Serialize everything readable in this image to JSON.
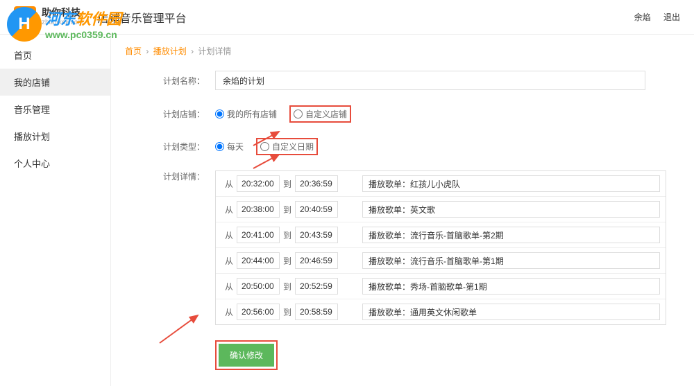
{
  "watermark": {
    "text1_part1": "河东",
    "text1_part2": "软件园",
    "text2": "www.pc0359.cn"
  },
  "header": {
    "logo_letter": "B",
    "logo_text1": "助你科技",
    "logo_text2": "zhunikeji.com",
    "title": "店铺音乐管理平台",
    "user": "余焰",
    "logout": "退出"
  },
  "sidebar": {
    "items": [
      {
        "label": "首页"
      },
      {
        "label": "我的店铺"
      },
      {
        "label": "音乐管理"
      },
      {
        "label": "播放计划"
      },
      {
        "label": "个人中心"
      }
    ]
  },
  "breadcrumb": {
    "item1": "首页",
    "item2": "播放计划",
    "item3": "计划详情"
  },
  "form": {
    "name_label": "计划名称：",
    "name_value": "余焰的计划",
    "shop_label": "计划店铺：",
    "shop_option1": "我的所有店铺",
    "shop_option2": "自定义店铺",
    "type_label": "计划类型：",
    "type_option1": "每天",
    "type_option2": "自定义日期",
    "details_label": "计划详情：",
    "from_label": "从",
    "to_label": "到",
    "playlist_prefix": "播放歌单：",
    "rows": [
      {
        "from": "20:32:00",
        "to": "20:36:59",
        "playlist": "红孩儿小虎队"
      },
      {
        "from": "20:38:00",
        "to": "20:40:59",
        "playlist": "英文歌"
      },
      {
        "from": "20:41:00",
        "to": "20:43:59",
        "playlist": "流行音乐-首脑歌单-第2期"
      },
      {
        "from": "20:44:00",
        "to": "20:46:59",
        "playlist": "流行音乐-首脑歌单-第1期"
      },
      {
        "from": "20:50:00",
        "to": "20:52:59",
        "playlist": "秀场-首脑歌单-第1期"
      },
      {
        "from": "20:56:00",
        "to": "20:58:59",
        "playlist": "通用英文休闲歌单"
      }
    ],
    "submit_label": "确认修改"
  }
}
